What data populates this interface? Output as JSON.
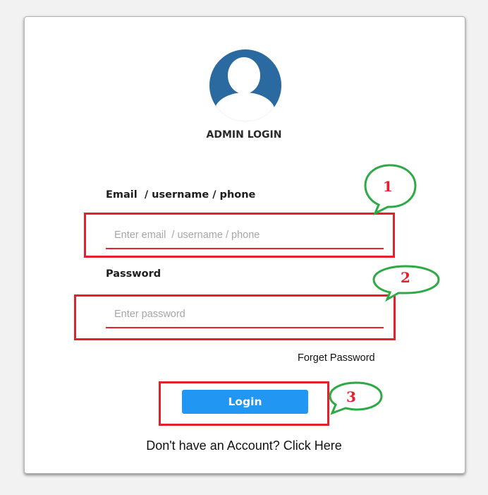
{
  "login": {
    "title": "ADMIN LOGIN",
    "email_label": "Email  / username / phone",
    "email_placeholder": "Enter email  / username / phone",
    "password_label": "Password",
    "password_placeholder": "Enter password",
    "forgot_label": "Forget Password",
    "login_label": "Login",
    "signup_text": "Don't have an Account? Click Here"
  },
  "annotations": {
    "callouts": [
      "1",
      "2",
      "3"
    ]
  },
  "icons": {
    "avatar": "user-avatar-icon"
  },
  "colors": {
    "page_background": "#f2f2f2",
    "avatar": "#2b6aa0",
    "input_underline": "#e8212e",
    "login_button": "#2196f3",
    "highlight_box": "#e3202c",
    "callout_bubble": "#2eaa44",
    "callout_number": "#e3202c"
  }
}
